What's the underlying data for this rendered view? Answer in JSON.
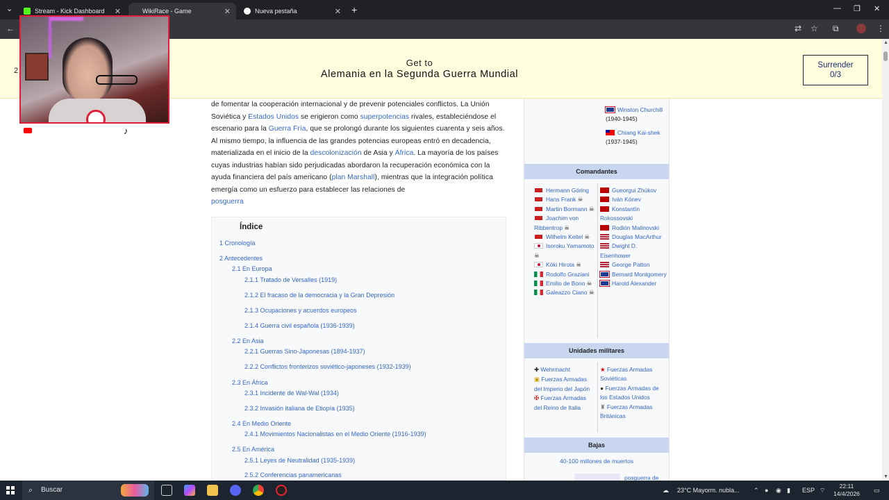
{
  "browser": {
    "tabs": [
      {
        "label": "Stream - Kick Dashboard",
        "icon": "kick-icon",
        "icon_color": "#53fc18",
        "active": false
      },
      {
        "label": "WikiRace - Game",
        "icon": "page-icon",
        "icon_color": "#35363a",
        "active": true
      },
      {
        "label": "Nueva pestaña",
        "icon": "chrome-icon",
        "icon_color": "#ffffff",
        "active": false
      }
    ],
    "new_tab": "+",
    "min": "—",
    "max": "❐",
    "close": "✕",
    "close_tab": "✕",
    "back": "←"
  },
  "game": {
    "get_to": "Get to",
    "target": "Alemania en la Segunda Guerra Mundial",
    "surrender_label": "Surrender",
    "surrender_count": "0/3",
    "side_number": "2",
    "banner_color": "#ffffe0"
  },
  "article": {
    "p_intro_1": "de fomentar la cooperación internacional y de prevenir potenciales conflictos. La Unión Soviética y ",
    "link_eeuu": "Estados Unidos",
    "p_intro_2": " se erigieron como ",
    "link_superpotencias": "superpotencias",
    "p_intro_3": " rivales, estableciéndose el escenario para la ",
    "link_guerra_fria": "Guerra Fría",
    "p_intro_4": ", que se prolongó durante los siguientes cuarenta y seis años. Al mismo tiempo, la influencia de las grandes potencias europeas entró en decadencia, materializada en el inicio de la ",
    "link_descolonizacion": "descolonización",
    "p_intro_5": " de Asia y ",
    "link_africa": "África",
    "p_intro_6": ". La mayoría de los países cuyas industrias habían sido perjudicadas abordaron la recuperación económica con la ayuda financiera del país americano (",
    "link_plan_marshall": "plan Marshall",
    "p_intro_7": "), mientras que la integración política emergía como un esfuerzo para establecer las relaciones de ",
    "link_posguerra": "posguerra"
  },
  "toc": {
    "title": "Índice",
    "entries": [
      "1 Cronología",
      "2 Antecedentes",
      "2.1 En Europa",
      "2.1.1 Tratado de Versalles (1919)",
      "2.1.2 El fracaso de la democracia y la Gran Depresión",
      "2.1.3 Ocupaciones y acuerdos europeos",
      "2.1.4 Guerra civil española (1936-1939)",
      "2.2 En Asia",
      "2.2.1 Guerras Sino-Japonesas (1894-1937)",
      "2.2.2 Conflictos fronterizos soviético-japoneses (1932-1939)",
      "2.3 En África",
      "2.3.1 Incidente de Wal-Wal (1934)",
      "2.3.2 Invasión italiana de Etiopía (1935)",
      "2.4 En Medio Oriente",
      "2.4.1 Movimientos Nacionalistas en el Medio Oriente (1916-1939)",
      "2.5 En América",
      "2.5.1 Leyes de Neutralidad (1935-1939)",
      "2.5.2 Conferencias panamericanas"
    ]
  },
  "infobox": {
    "top_right": [
      {
        "flag": "gb",
        "name": "Winston Churchill",
        "note": " (1940-1945)"
      },
      {
        "flag": "cn",
        "name": "Chiang Kai-shek",
        "note": " (1937-1945)"
      }
    ],
    "commanders_header": "Comandantes",
    "commanders_axis": [
      {
        "flag": "de",
        "name": "Hermann Göring",
        "note": ""
      },
      {
        "flag": "de",
        "name": "Hans Frank",
        "note": " ☠"
      },
      {
        "flag": "de",
        "name": "Martin Bormann",
        "note": " ☠"
      },
      {
        "flag": "de",
        "name": "Joachim von Ribbentrop",
        "note": " ☠"
      },
      {
        "flag": "de",
        "name": "Wilhelm Keitel",
        "note": " ☠"
      },
      {
        "flag": "jp",
        "name": "Isoroku Yamamoto",
        "note": " ☠"
      },
      {
        "flag": "jp",
        "name": "Kōki Hirota",
        "note": " ☠"
      },
      {
        "flag": "it",
        "name": "Rodolfo Graziani",
        "note": ""
      },
      {
        "flag": "it",
        "name": "Emilio de Bono",
        "note": " ☠"
      },
      {
        "flag": "it",
        "name": "Galeazzo Ciano",
        "note": " ☠"
      }
    ],
    "commanders_allies": [
      {
        "flag": "su",
        "name": "Gueorgui Zhúkov",
        "note": ""
      },
      {
        "flag": "su",
        "name": "Iván Kónev",
        "note": ""
      },
      {
        "flag": "su",
        "name": "Konstantín Rokossovski",
        "note": ""
      },
      {
        "flag": "su",
        "name": "Rodión Malinovski",
        "note": ""
      },
      {
        "flag": "us",
        "name": "Douglas MacArthur",
        "note": ""
      },
      {
        "flag": "us",
        "name": "Dwight D. Eisenhower",
        "note": ""
      },
      {
        "flag": "us",
        "name": "George Patton",
        "note": ""
      },
      {
        "flag": "gb",
        "name": "Bernard Montgomery",
        "note": ""
      },
      {
        "flag": "gb",
        "name": "Harold Alexander",
        "note": ""
      }
    ],
    "units_header": "Unidades militares",
    "units_axis": [
      "Wehrmacht",
      "Fuerzas Armadas del Imperio del Japón",
      "Fuerzas Armadas del Reino de Italia"
    ],
    "units_allies": [
      "Fuerzas Armadas Soviéticas",
      "Fuerzas Armadas de los Estados Unidos",
      "Fuerzas Armadas Británicas"
    ],
    "units_axis_icons": [
      "✚",
      "▣",
      "✠"
    ],
    "units_allies_icons": [
      "★",
      "●",
      "♜"
    ],
    "casualties_header": "Bajas",
    "casualties_total": "40-100 millones de muertos",
    "bottom_link": "posguerra de",
    "header_color": "#c8d6f0"
  },
  "taskbar": {
    "search_placeholder": "Buscar",
    "weather": "23°C  Mayorm. nubla...",
    "lang": "ESP",
    "time": "22:11",
    "date": "14/4/2026"
  }
}
